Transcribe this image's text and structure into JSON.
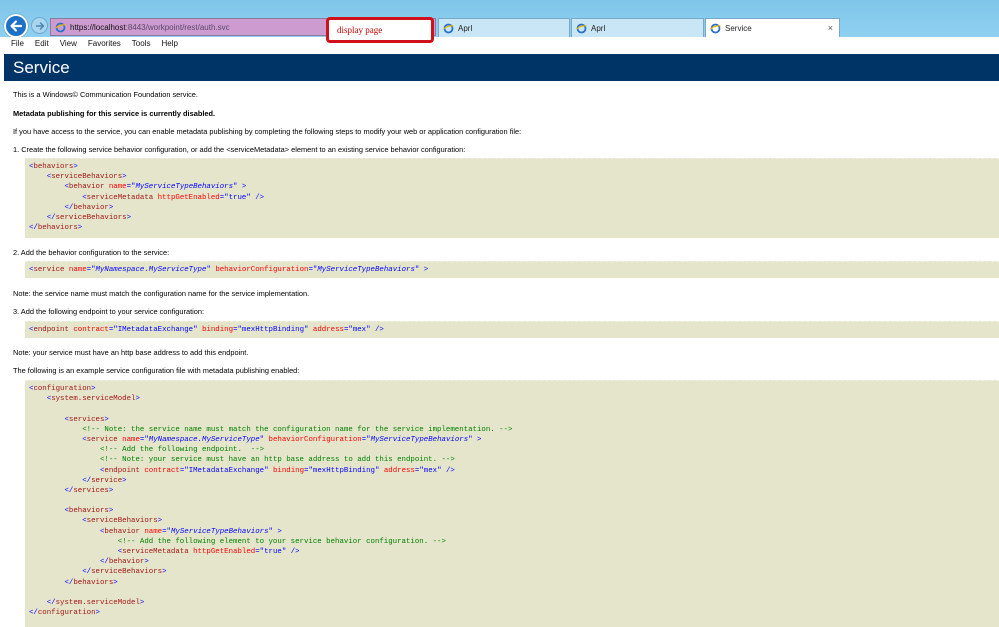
{
  "browser": {
    "address": {
      "host": "https://localhost",
      "rest": ":8443/workpoint/rest/auth.svc"
    },
    "callout_label": "display page",
    "tabs": [
      {
        "label": "Aprl"
      },
      {
        "label": "Aprl"
      },
      {
        "label": "Service",
        "close": "×"
      }
    ],
    "menu": [
      "File",
      "Edit",
      "View",
      "Favorites",
      "Tools",
      "Help"
    ]
  },
  "page": {
    "title": "Service",
    "intro": "This is a Windows© Communication Foundation service.",
    "disabled_note": "Metadata publishing for this service is currently disabled.",
    "access_note": "If you have access to the service, you can enable metadata publishing by completing the following steps to modify your web or application configuration file:",
    "step1": "1. Create the following service behavior configuration, or add the <serviceMetadata> element to an existing service behavior configuration:",
    "step2": "2. Add the behavior configuration to the service:",
    "note_name": "Note: the service name must match the configuration name for the service implementation.",
    "step3": "3. Add the following endpoint to your service configuration:",
    "note_base": "Note: your service must have an http base address to add this endpoint.",
    "example_intro": "The following is an example service configuration file with metadata publishing enabled:"
  },
  "code": {
    "block1": [
      [
        [
          "t",
          "<"
        ],
        [
          "e",
          "behaviors"
        ],
        [
          "t",
          ">"
        ]
      ],
      [
        [
          "",
          "    "
        ],
        [
          "t",
          "<"
        ],
        [
          "e",
          "serviceBehaviors"
        ],
        [
          "t",
          ">"
        ]
      ],
      [
        [
          "",
          "        "
        ],
        [
          "t",
          "<"
        ],
        [
          "e",
          "behavior "
        ],
        [
          "a",
          "name"
        ],
        [
          "t",
          "=\""
        ],
        [
          "vi",
          "MyServiceTypeBehaviors"
        ],
        [
          "t",
          "\" >"
        ]
      ],
      [
        [
          "",
          "            "
        ],
        [
          "t",
          "<"
        ],
        [
          "e",
          "serviceMetadata "
        ],
        [
          "a",
          "httpGetEnabled"
        ],
        [
          "t",
          "=\""
        ],
        [
          "v",
          "true"
        ],
        [
          "t",
          "\" />"
        ]
      ],
      [
        [
          "",
          "        "
        ],
        [
          "t",
          "</"
        ],
        [
          "e",
          "behavior"
        ],
        [
          "t",
          ">"
        ]
      ],
      [
        [
          "",
          "    "
        ],
        [
          "t",
          "</"
        ],
        [
          "e",
          "serviceBehaviors"
        ],
        [
          "t",
          ">"
        ]
      ],
      [
        [
          "t",
          "</"
        ],
        [
          "e",
          "behaviors"
        ],
        [
          "t",
          ">"
        ]
      ]
    ],
    "block2": [
      [
        [
          "t",
          "<"
        ],
        [
          "e",
          "service "
        ],
        [
          "a",
          "name"
        ],
        [
          "t",
          "=\""
        ],
        [
          "vi",
          "MyNamespace.MyServiceType"
        ],
        [
          "t",
          "\" "
        ],
        [
          "a",
          "behaviorConfiguration"
        ],
        [
          "t",
          "=\""
        ],
        [
          "vi",
          "MyServiceTypeBehaviors"
        ],
        [
          "t",
          "\" >"
        ]
      ]
    ],
    "block3": [
      [
        [
          "t",
          "<"
        ],
        [
          "e",
          "endpoint "
        ],
        [
          "a",
          "contract"
        ],
        [
          "t",
          "=\""
        ],
        [
          "v",
          "IMetadataExchange"
        ],
        [
          "t",
          "\" "
        ],
        [
          "a",
          "binding"
        ],
        [
          "t",
          "=\""
        ],
        [
          "v",
          "mexHttpBinding"
        ],
        [
          "t",
          "\" "
        ],
        [
          "a",
          "address"
        ],
        [
          "t",
          "=\""
        ],
        [
          "v",
          "mex"
        ],
        [
          "t",
          "\" />"
        ]
      ]
    ],
    "block4": [
      [
        [
          "t",
          "<"
        ],
        [
          "e",
          "configuration"
        ],
        [
          "t",
          ">"
        ]
      ],
      [
        [
          "",
          "    "
        ],
        [
          "t",
          "<"
        ],
        [
          "e",
          "system.serviceModel"
        ],
        [
          "t",
          ">"
        ]
      ],
      [
        [
          "",
          ""
        ]
      ],
      [
        [
          "",
          "        "
        ],
        [
          "t",
          "<"
        ],
        [
          "e",
          "services"
        ],
        [
          "t",
          ">"
        ]
      ],
      [
        [
          "",
          "            "
        ],
        [
          "c",
          "<!-- Note: the service name must match the configuration name for the service implementation. -->"
        ]
      ],
      [
        [
          "",
          "            "
        ],
        [
          "t",
          "<"
        ],
        [
          "e",
          "service "
        ],
        [
          "a",
          "name"
        ],
        [
          "t",
          "=\""
        ],
        [
          "vi",
          "MyNamespace.MyServiceType"
        ],
        [
          "t",
          "\" "
        ],
        [
          "a",
          "behaviorConfiguration"
        ],
        [
          "t",
          "=\""
        ],
        [
          "vi",
          "MyServiceTypeBehaviors"
        ],
        [
          "t",
          "\" >"
        ]
      ],
      [
        [
          "",
          "                "
        ],
        [
          "c",
          "<!-- Add the following endpoint.  -->"
        ]
      ],
      [
        [
          "",
          "                "
        ],
        [
          "c",
          "<!-- Note: your service must have an http base address to add this endpoint. -->"
        ]
      ],
      [
        [
          "",
          "                "
        ],
        [
          "t",
          "<"
        ],
        [
          "e",
          "endpoint "
        ],
        [
          "a",
          "contract"
        ],
        [
          "t",
          "=\""
        ],
        [
          "v",
          "IMetadataExchange"
        ],
        [
          "t",
          "\" "
        ],
        [
          "a",
          "binding"
        ],
        [
          "t",
          "=\""
        ],
        [
          "v",
          "mexHttpBinding"
        ],
        [
          "t",
          "\" "
        ],
        [
          "a",
          "address"
        ],
        [
          "t",
          "=\""
        ],
        [
          "v",
          "mex"
        ],
        [
          "t",
          "\" />"
        ]
      ],
      [
        [
          "",
          "            "
        ],
        [
          "t",
          "</"
        ],
        [
          "e",
          "service"
        ],
        [
          "t",
          ">"
        ]
      ],
      [
        [
          "",
          "        "
        ],
        [
          "t",
          "</"
        ],
        [
          "e",
          "services"
        ],
        [
          "t",
          ">"
        ]
      ],
      [
        [
          "",
          ""
        ]
      ],
      [
        [
          "",
          "        "
        ],
        [
          "t",
          "<"
        ],
        [
          "e",
          "behaviors"
        ],
        [
          "t",
          ">"
        ]
      ],
      [
        [
          "",
          "            "
        ],
        [
          "t",
          "<"
        ],
        [
          "e",
          "serviceBehaviors"
        ],
        [
          "t",
          ">"
        ]
      ],
      [
        [
          "",
          "                "
        ],
        [
          "t",
          "<"
        ],
        [
          "e",
          "behavior "
        ],
        [
          "a",
          "name"
        ],
        [
          "t",
          "=\""
        ],
        [
          "vi",
          "MyServiceTypeBehaviors"
        ],
        [
          "t",
          "\" >"
        ]
      ],
      [
        [
          "",
          "                    "
        ],
        [
          "c",
          "<!-- Add the following element to your service behavior configuration. -->"
        ]
      ],
      [
        [
          "",
          "                    "
        ],
        [
          "t",
          "<"
        ],
        [
          "e",
          "serviceMetadata "
        ],
        [
          "a",
          "httpGetEnabled"
        ],
        [
          "t",
          "=\""
        ],
        [
          "v",
          "true"
        ],
        [
          "t",
          "\" />"
        ]
      ],
      [
        [
          "",
          "                "
        ],
        [
          "t",
          "</"
        ],
        [
          "e",
          "behavior"
        ],
        [
          "t",
          ">"
        ]
      ],
      [
        [
          "",
          "            "
        ],
        [
          "t",
          "</"
        ],
        [
          "e",
          "serviceBehaviors"
        ],
        [
          "t",
          ">"
        ]
      ],
      [
        [
          "",
          "        "
        ],
        [
          "t",
          "</"
        ],
        [
          "e",
          "behaviors"
        ],
        [
          "t",
          ">"
        ]
      ],
      [
        [
          "",
          ""
        ]
      ],
      [
        [
          "",
          "    "
        ],
        [
          "t",
          "</"
        ],
        [
          "e",
          "system.serviceModel"
        ],
        [
          "t",
          ">"
        ]
      ],
      [
        [
          "t",
          "</"
        ],
        [
          "e",
          "configuration"
        ],
        [
          "t",
          ">"
        ]
      ]
    ]
  }
}
